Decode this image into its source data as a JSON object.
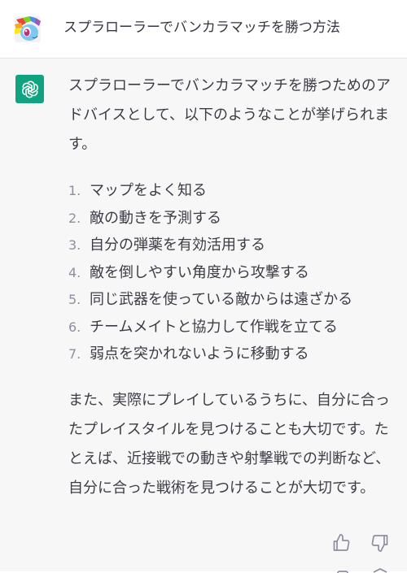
{
  "user": {
    "avatar_icon": "rainbow-pony-avatar",
    "message": "スプラローラーでバンカラマッチを勝つ方法"
  },
  "assistant": {
    "avatar_icon": "openai-logo-icon",
    "accent_color": "#10a37f",
    "intro": "スプラローラーでバンカラマッチを勝つためのアドバイスとして、以下のようなことが挙げられます。",
    "steps": [
      {
        "num": "1.",
        "text": "マップをよく知る"
      },
      {
        "num": "2.",
        "text": "敵の動きを予測する"
      },
      {
        "num": "3.",
        "text": "自分の弾薬を有効活用する"
      },
      {
        "num": "4.",
        "text": "敵を倒しやすい角度から攻撃する"
      },
      {
        "num": "5.",
        "text": "同じ武器を使っている敵からは遠ざかる"
      },
      {
        "num": "6.",
        "text": "チームメイトと協力して作戦を立てる"
      },
      {
        "num": "7.",
        "text": "弱点を突かれないように移動する"
      }
    ],
    "outro": "また、実際にプレイしているうちに、自分に合ったプレイスタイルを見つけることも大切です。たとえば、近接戦での動きや射撃戦での判断など、自分に合った戦術を見つけることが大切です。",
    "feedback": {
      "up_icon": "thumbs-up-icon",
      "down_icon": "thumbs-down-icon"
    }
  }
}
